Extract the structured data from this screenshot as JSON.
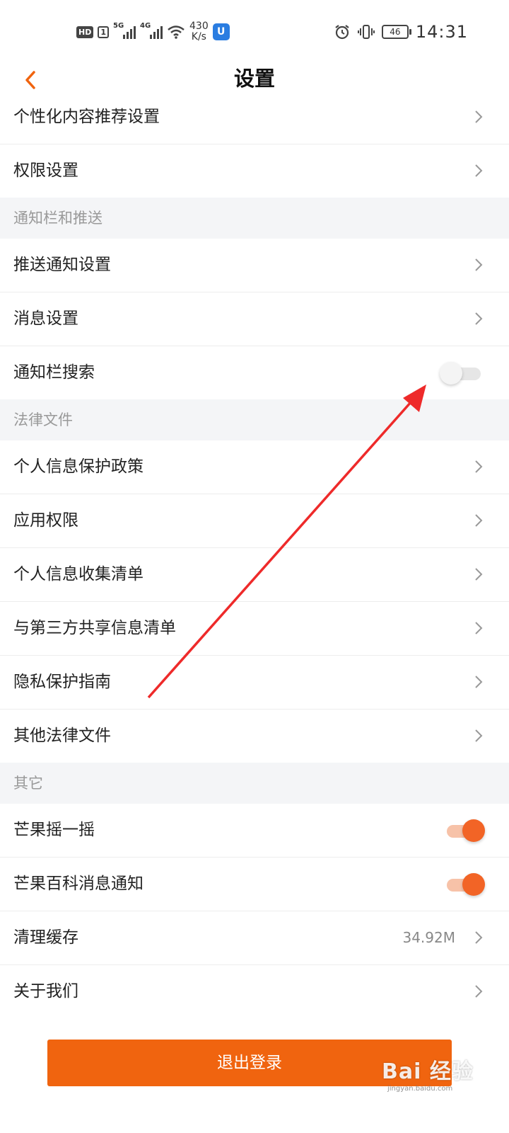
{
  "status_bar": {
    "hd": "HD",
    "sim": "1",
    "gen1": "5G",
    "gen2": "4G",
    "net_speed_value": "430",
    "net_speed_unit": "K/s",
    "battery": "46",
    "time": "14:31",
    "icons": [
      "signal-5g-icon",
      "signal-4g-icon",
      "wifi-icon",
      "app-notify-icon",
      "alarm-icon",
      "vibrate-icon",
      "battery-icon"
    ]
  },
  "header": {
    "title": "设置"
  },
  "sections": {
    "top_items": [
      {
        "label": "个性化内容推荐设置"
      },
      {
        "label": "权限设置"
      }
    ],
    "notify": {
      "title": "通知栏和推送",
      "items": [
        {
          "label": "推送通知设置"
        },
        {
          "label": "消息设置"
        },
        {
          "label": "通知栏搜索",
          "toggle": false
        }
      ]
    },
    "legal": {
      "title": "法律文件",
      "items": [
        {
          "label": "个人信息保护政策"
        },
        {
          "label": "应用权限"
        },
        {
          "label": "个人信息收集清单"
        },
        {
          "label": "与第三方共享信息清单"
        },
        {
          "label": "隐私保护指南"
        },
        {
          "label": "其他法律文件"
        }
      ]
    },
    "other": {
      "title": "其它",
      "items": [
        {
          "label": "芒果摇一摇",
          "toggle": true
        },
        {
          "label": "芒果百科消息通知",
          "toggle": true
        },
        {
          "label": "清理缓存",
          "value": "34.92M"
        },
        {
          "label": "关于我们"
        }
      ]
    }
  },
  "logout_label": "退出登录",
  "colors": {
    "accent": "#f0640f",
    "toggle_on": "#f26426",
    "section_bg": "#f4f5f7",
    "annotation_arrow": "#ee2a2a"
  },
  "watermark": {
    "main": "Bai 经验",
    "sub": "jingyan.baidu.com"
  }
}
